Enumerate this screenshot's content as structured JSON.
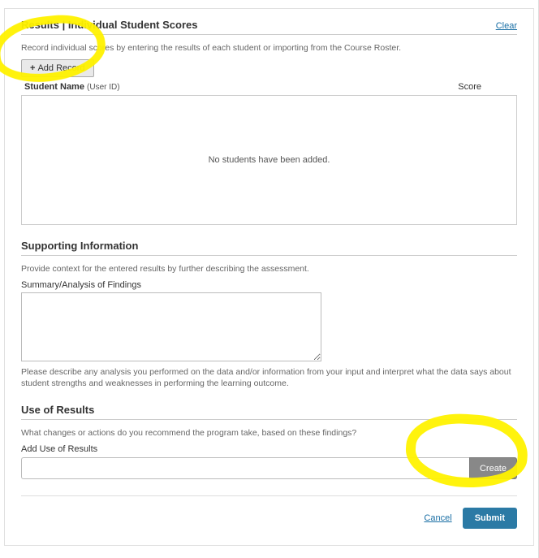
{
  "results": {
    "header": "Results | Individual Student Scores",
    "clear": "Clear",
    "intro": "Record individual scores by entering the results of each student or importing from the Course Roster.",
    "addRecord": "Add Record",
    "studentNameHeader": "Student Name",
    "userIdLabel": "(User ID)",
    "scoreHeader": "Score",
    "emptyRows": "No students have been added.",
    "students": []
  },
  "supporting": {
    "header": "Supporting Information",
    "intro": "Provide context for the entered results by further describing the assessment.",
    "summaryLabel": "Summary/Analysis of Findings",
    "summaryValue": "",
    "summaryHelp": "Please describe any analysis you performed on the data and/or information from your input and interpret what the data says about student strengths and weaknesses in performing the learning outcome."
  },
  "useOfResults": {
    "header": "Use of Results",
    "prompt": "What changes or actions do you recommend the program take, based on these findings?",
    "addLabel": "Add Use of Results",
    "addValue": "",
    "createBtn": "Create"
  },
  "footer": {
    "cancel": "Cancel",
    "submit": "Submit"
  }
}
